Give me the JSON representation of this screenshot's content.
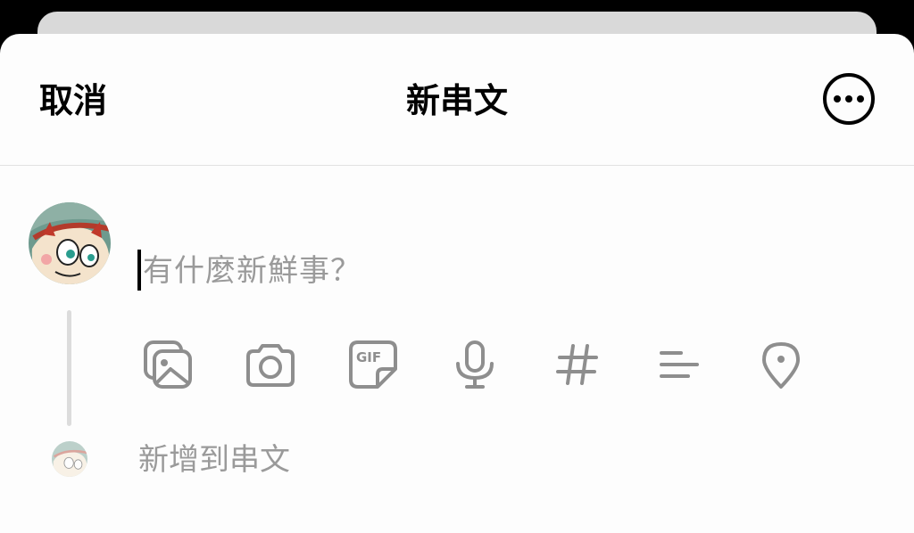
{
  "header": {
    "cancel_label": "取消",
    "title": "新串文",
    "more_icon": "more-horizontal-circle-icon"
  },
  "composer": {
    "placeholder": "有什麼新鮮事？",
    "avatar": "user-avatar"
  },
  "toolbar": {
    "icons": [
      "gallery-icon",
      "camera-icon",
      "gif-icon",
      "microphone-icon",
      "hashtag-icon",
      "poll-icon",
      "location-icon"
    ],
    "gif_text": "GIF"
  },
  "add_thread": {
    "label": "新增到串文"
  },
  "colors": {
    "accent": "#000000",
    "muted": "#9a9a9a",
    "icon": "#8e8e8e",
    "divider": "#e1e1e1"
  }
}
